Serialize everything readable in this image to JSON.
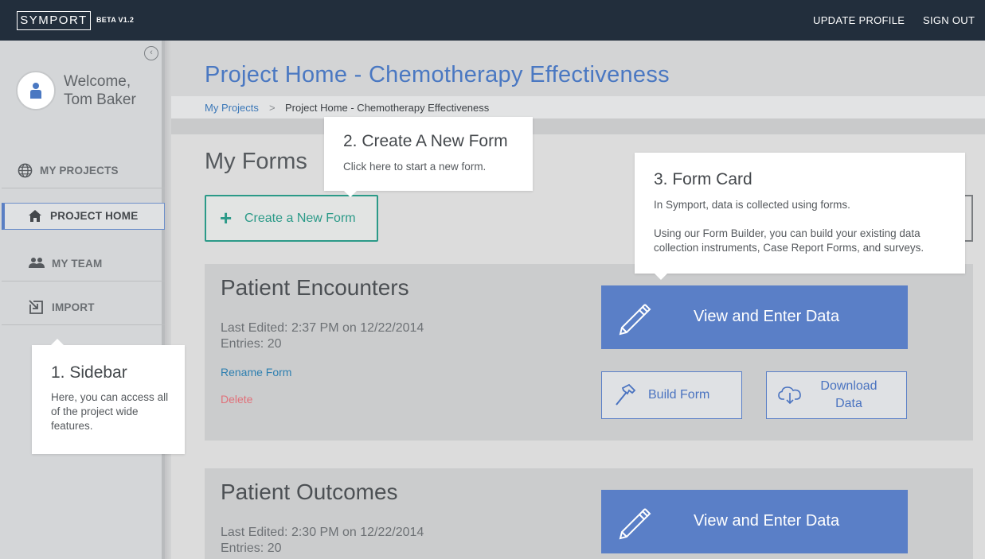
{
  "header": {
    "logo": "SYMPORT",
    "beta": "BETA V1.2",
    "update_profile": "UPDATE PROFILE",
    "sign_out": "SIGN OUT"
  },
  "sidebar": {
    "welcome_line1": "Welcome,",
    "welcome_line2": "Tom Baker",
    "items": [
      {
        "label": "MY PROJECTS",
        "icon": "globe-icon"
      },
      {
        "label": "PROJECT HOME",
        "icon": "home-icon",
        "active": true
      },
      {
        "label": "MY TEAM",
        "icon": "team-icon"
      },
      {
        "label": "IMPORT",
        "icon": "import-icon"
      }
    ]
  },
  "main": {
    "page_title": "Project Home - Chemotherapy Effectiveness",
    "breadcrumb": {
      "link": "My Projects",
      "separator": ">",
      "current": "Project Home - Chemotherapy Effectiveness"
    },
    "forms_title": "My Forms",
    "create_label": "Create a New Form",
    "forms": [
      {
        "title": "Patient Encounters",
        "last_edited": "Last Edited: 2:37 PM on 12/22/2014",
        "entries": "Entries: 20",
        "rename": "Rename Form",
        "delete": "Delete",
        "view_label": "View and Enter Data",
        "build_label": "Build Form",
        "download_line1": "Download",
        "download_line2": "Data"
      },
      {
        "title": "Patient Outcomes",
        "last_edited": "Last Edited: 2:30 PM on 12/22/2014",
        "entries": "Entries: 20",
        "view_label": "View and Enter Data"
      }
    ]
  },
  "tooltips": {
    "sidebar": {
      "title": "1. Sidebar",
      "body": "Here, you can access all of the project wide features."
    },
    "create": {
      "title": "2. Create A New Form",
      "body": "Click here to start a new form."
    },
    "card": {
      "title": "3. Form Card",
      "body1": "In Symport, data is collected using forms.",
      "body2": "Using our Form Builder, you can build your existing data collection instruments, Case Report Forms, and surveys."
    }
  },
  "colors": {
    "header_bg": "#222e3c",
    "accent_blue": "#5a7fc7",
    "accent_teal": "#2b9a88",
    "delete_red": "#e0717a"
  }
}
